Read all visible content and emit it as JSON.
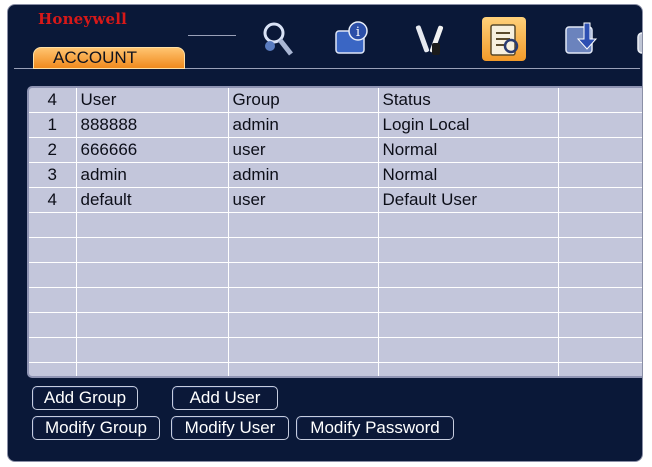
{
  "header": {
    "brand": "Honeywell",
    "tab_label": "ACCOUNT"
  },
  "toolbar": {
    "icons": [
      {
        "name": "search-icon",
        "glyph": "🔍"
      },
      {
        "name": "info-book-icon",
        "glyph": "📘"
      },
      {
        "name": "tools-icon",
        "glyph": "🔧"
      },
      {
        "name": "account-icon",
        "glyph": "📋",
        "active": true
      },
      {
        "name": "backup-icon",
        "glyph": "⇩"
      },
      {
        "name": "shutdown-icon",
        "glyph": "⏻"
      }
    ]
  },
  "table": {
    "header": {
      "num": "4",
      "user": "User",
      "group": "Group",
      "status": "Status"
    },
    "rows": [
      {
        "num": "1",
        "user": "888888",
        "group": "admin",
        "status": "Login Local"
      },
      {
        "num": "2",
        "user": "666666",
        "group": "user",
        "status": "Normal"
      },
      {
        "num": "3",
        "user": "admin",
        "group": "admin",
        "status": "Normal"
      },
      {
        "num": "4",
        "user": "default",
        "group": "user",
        "status": "Default User"
      }
    ],
    "empty_rows": 7
  },
  "buttons": {
    "add_group": "Add Group",
    "add_user": "Add User",
    "modify_group": "Modify Group",
    "modify_user": "Modify User",
    "modify_password": "Modify Password"
  },
  "colors": {
    "background": "#0a1838",
    "table_bg": "#c3c6db",
    "tab_accent": "#f08a1e",
    "brand": "#d81818"
  }
}
